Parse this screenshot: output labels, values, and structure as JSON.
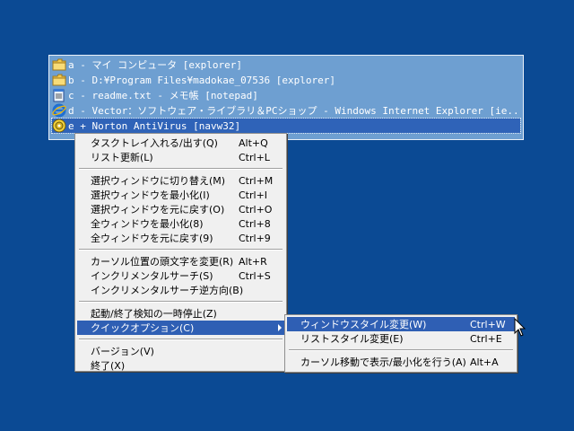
{
  "window_list": [
    {
      "key": "a",
      "sep": " - ",
      "title": "マイ コンピュータ [explorer]",
      "icon": "folder-icon"
    },
    {
      "key": "b",
      "sep": " - ",
      "title": "D:¥Program Files¥madokae_07536 [explorer]",
      "icon": "folder-icon"
    },
    {
      "key": "c",
      "sep": " - ",
      "title": "readme.txt - メモ帳 [notepad]",
      "icon": "notepad-icon"
    },
    {
      "key": "d",
      "sep": " - ",
      "title": "Vector：ソフトウェア・ライブラリ＆PCショップ - Windows Internet Explorer [ie...",
      "icon": "ie-icon"
    },
    {
      "key": "e",
      "sep": " + ",
      "title": "Norton AntiVirus [navw32]",
      "icon": "norton-icon"
    }
  ],
  "context_menu": {
    "groups": [
      [
        {
          "label": "タスクトレイ入れる/出す(Q)",
          "shortcut": "Alt+Q"
        },
        {
          "label": "リスト更新(L)",
          "shortcut": "Ctrl+L"
        }
      ],
      [
        {
          "label": "選択ウィンドウに切り替え(M)",
          "shortcut": "Ctrl+M"
        },
        {
          "label": "選択ウィンドウを最小化(I)",
          "shortcut": "Ctrl+I"
        },
        {
          "label": "選択ウィンドウを元に戻す(O)",
          "shortcut": "Ctrl+O"
        },
        {
          "label": "全ウィンドウを最小化(8)",
          "shortcut": "Ctrl+8"
        },
        {
          "label": "全ウィンドウを元に戻す(9)",
          "shortcut": "Ctrl+9"
        }
      ],
      [
        {
          "label": "カーソル位置の頭文字を変更(R)",
          "shortcut": "Alt+R"
        },
        {
          "label": "インクリメンタルサーチ(S)",
          "shortcut": "Ctrl+S"
        },
        {
          "label": "インクリメンタルサーチ逆方向(B)",
          "shortcut": ""
        }
      ],
      [
        {
          "label": "起動/終了検知の一時停止(Z)",
          "shortcut": ""
        },
        {
          "label": "クイックオプション(C)",
          "shortcut": "",
          "submenu": true,
          "highlighted": true
        }
      ],
      [
        {
          "label": "バージョン(V)",
          "shortcut": ""
        },
        {
          "label": "終了(X)",
          "shortcut": ""
        }
      ]
    ]
  },
  "submenu": {
    "groups": [
      [
        {
          "label": "ウィンドウスタイル変更(W)",
          "shortcut": "Ctrl+W",
          "highlighted": true
        },
        {
          "label": "リストスタイル変更(E)",
          "shortcut": "Ctrl+E"
        }
      ],
      [
        {
          "label": "カーソル移動で表示/最小化を行う(A)",
          "shortcut": "Alt+A"
        }
      ]
    ]
  }
}
